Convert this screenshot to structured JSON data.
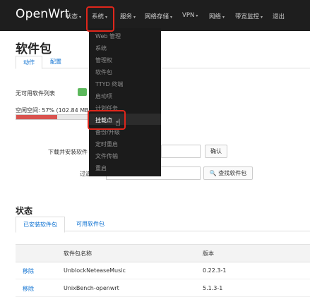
{
  "nav": {
    "brand": "OpenWrt",
    "items": [
      {
        "label": "状态"
      },
      {
        "label": "系统"
      },
      {
        "label": "服务"
      },
      {
        "label": "网络存储"
      },
      {
        "label": "VPN"
      },
      {
        "label": "网络"
      },
      {
        "label": "带宽监控"
      },
      {
        "label": "退出"
      }
    ],
    "dropdown": [
      "Web 管理",
      "系统",
      "管理权",
      "软件包",
      "TTYD 终端",
      "启动项",
      "计划任务",
      "挂载点",
      "备份/升级",
      "定时重启",
      "文件传输",
      "重启"
    ],
    "highlighted_item": "挂载点"
  },
  "page": {
    "title": "软件包",
    "tabs": [
      "动作",
      "配置"
    ],
    "no_packages_label": "无可用软件列表",
    "disk_label": "空闲空间: 57% (102.84 MB)",
    "disk_free_fraction": 0.57,
    "install_label": "下载并安装软件",
    "install_button": "确认",
    "filter_label": "过滤",
    "search_button": "查找软件包"
  },
  "status": {
    "title": "状态",
    "tabs": [
      "已安装软件包",
      "可用软件包"
    ],
    "columns": [
      "软件包名称",
      "版本"
    ],
    "rows": [
      {
        "action": "移除",
        "name": "UnblockNeteaseMusic",
        "version": "0.22.3-1"
      },
      {
        "action": "移除",
        "name": "UnixBench-openwrt",
        "version": "5.1.3-1"
      }
    ]
  },
  "colors": {
    "nav_bg": "#1e1e1e",
    "dropdown_bg": "#1b1b1b",
    "highlight_box": "#e0261b",
    "link": "#0a6fd1",
    "disk_bar": "#d9534f"
  }
}
